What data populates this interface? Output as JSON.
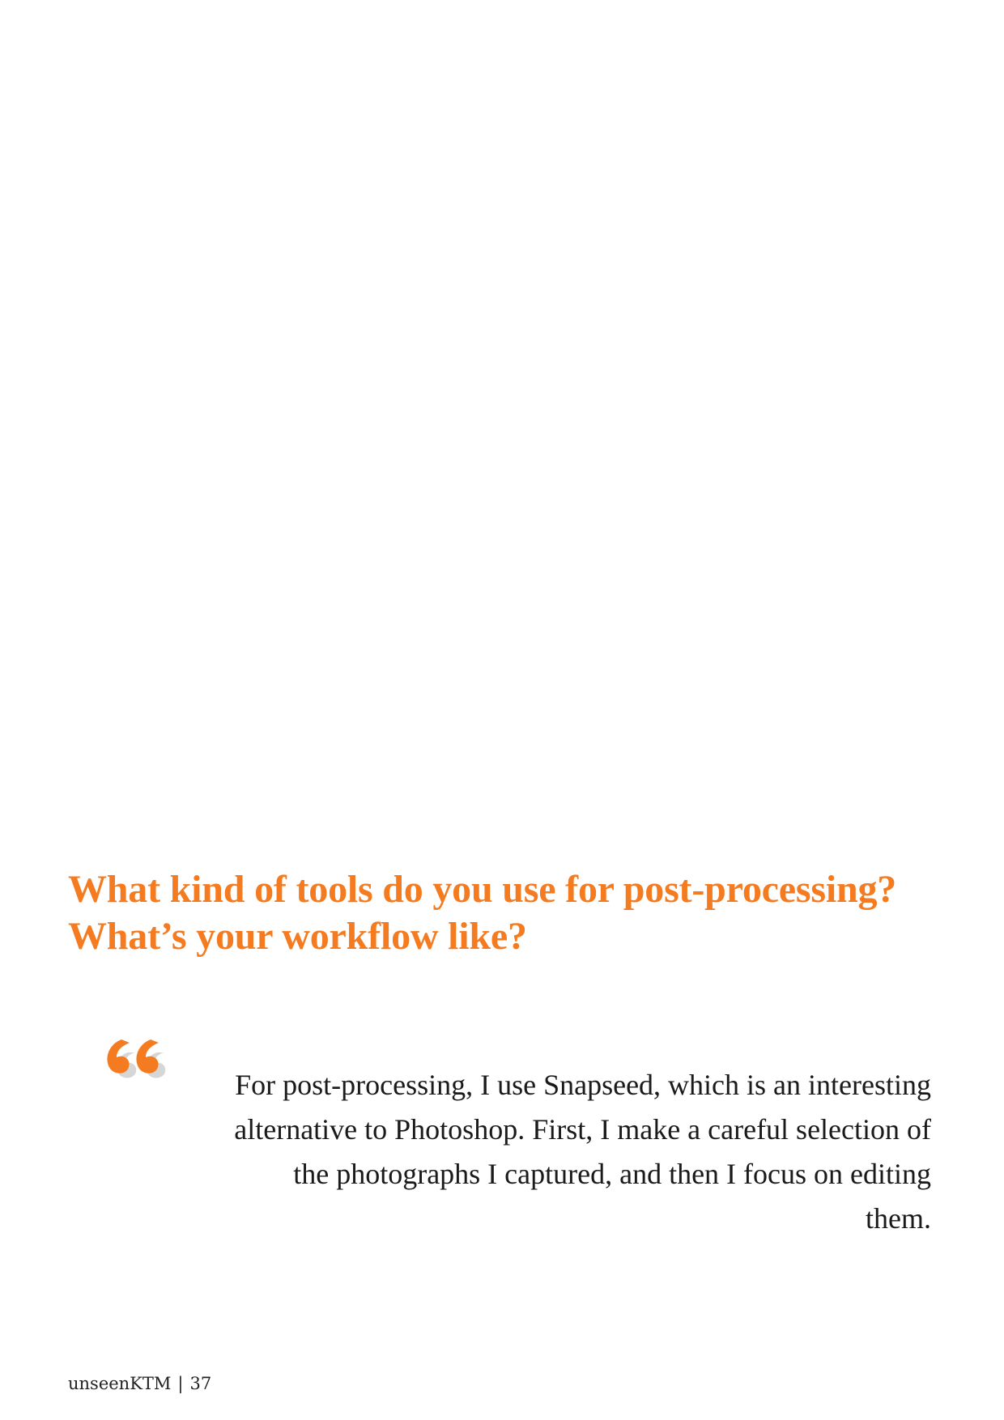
{
  "question": {
    "line1": "What kind of tools do you use for post-processing?",
    "line2": "What’s your workflow like?"
  },
  "answer": {
    "lines": [
      "For post-processing, I use Snapseed, which is an interesting",
      "alternative to Photoshop. First, I make a careful selection of",
      "the photographs I captured, and then I focus on editing",
      "them."
    ]
  },
  "footer": {
    "publication": "unseenKTM",
    "separator": "|",
    "page_number": "37"
  },
  "colors": {
    "accent": "#F47B20",
    "quote_shadow": "#D6D6D6",
    "text": "#1a1a1a"
  },
  "icons": {
    "quote": "open-quote-icon"
  }
}
